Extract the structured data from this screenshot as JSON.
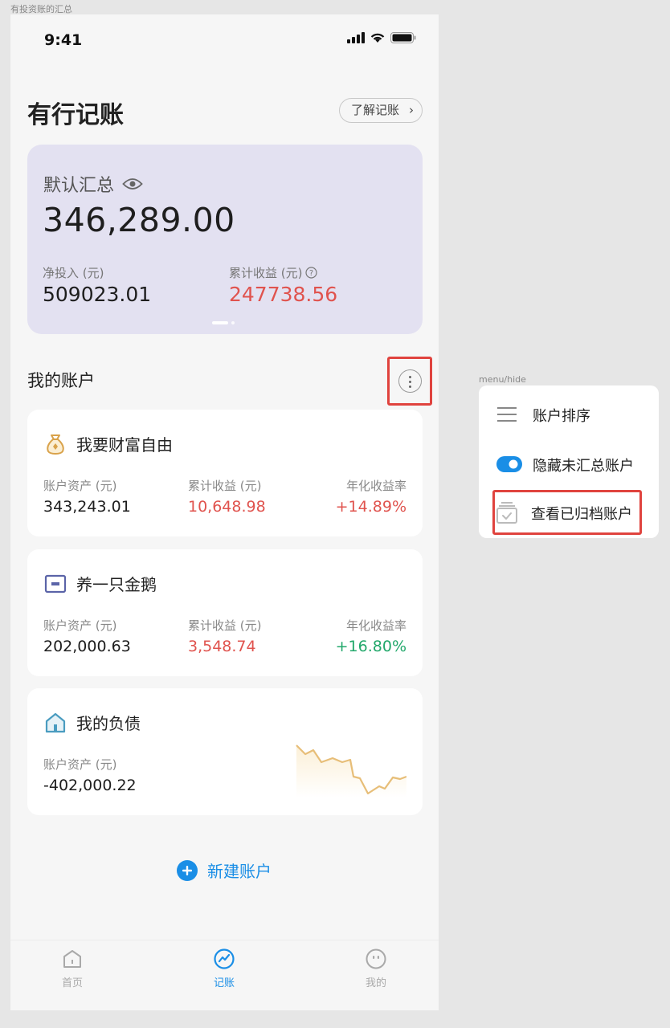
{
  "frame_title": "有投资账的汇总",
  "menu_frame_title": "menu/hide",
  "status": {
    "time": "9:41"
  },
  "header": {
    "title": "有行记账",
    "learn_button": "了解记账"
  },
  "summary": {
    "label": "默认汇总",
    "total": "346,289.00",
    "net_invest_label": "净投入 (元)",
    "net_invest_value": "509023.01",
    "cum_income_label": "累计收益 (元)",
    "cum_income_value": "247738.56"
  },
  "section": {
    "title": "我的账户"
  },
  "accounts": [
    {
      "name": "我要财富自由",
      "icon": "money-bag-icon",
      "asset_label": "账户资产 (元)",
      "asset_value": "343,243.01",
      "income_label": "累计收益 (元)",
      "income_value": "10,648.98",
      "rate_label": "年化收益率",
      "rate_value": "+14.89%"
    },
    {
      "name": "养一只金鹅",
      "icon": "wallet-icon",
      "asset_label": "账户资产 (元)",
      "asset_value": "202,000.63",
      "income_label": "累计收益 (元)",
      "income_value": "3,548.74",
      "rate_label": "年化收益率",
      "rate_value": "+16.80%"
    },
    {
      "name": "我的负债",
      "icon": "house-icon",
      "asset_label": "账户资产 (元)",
      "asset_value": "-402,000.22"
    }
  ],
  "new_account": {
    "label": "新建账户"
  },
  "tabs": [
    {
      "label": "首页",
      "icon": "home-icon"
    },
    {
      "label": "记账",
      "icon": "chart-icon"
    },
    {
      "label": "我的",
      "icon": "profile-icon"
    }
  ],
  "menu": {
    "items": [
      {
        "label": "账户排序",
        "icon": "sort-icon"
      },
      {
        "label": "隐藏未汇总账户",
        "icon": "toggle-icon"
      },
      {
        "label": "查看已归档账户",
        "icon": "archive-icon"
      }
    ]
  },
  "colors": {
    "accent": "#1a8ee6",
    "positive": "#e0534e",
    "growth_green": "#22a86b",
    "card_purple": "#e3e1f1"
  }
}
